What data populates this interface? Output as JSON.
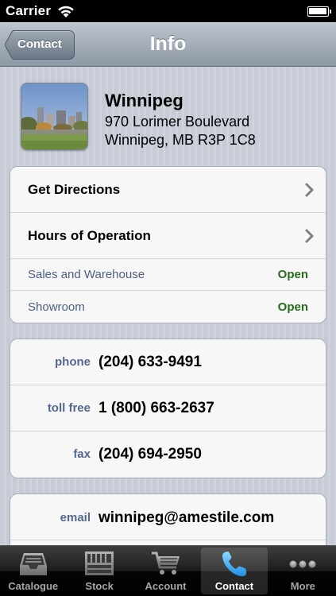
{
  "status_bar": {
    "carrier": "Carrier"
  },
  "nav": {
    "title": "Info",
    "back_label": "Contact"
  },
  "location": {
    "name": "Winnipeg",
    "address_line1": "970 Lorimer Boulevard",
    "address_line2": "Winnipeg, MB R3P 1C8"
  },
  "actions": [
    {
      "label": "Get Directions"
    },
    {
      "label": "Hours of Operation"
    }
  ],
  "hours": [
    {
      "name": "Sales and Warehouse",
      "status": "Open"
    },
    {
      "name": "Showroom",
      "status": "Open"
    }
  ],
  "phones": [
    {
      "label": "phone",
      "value": "(204) 633-9491"
    },
    {
      "label": "toll free",
      "value": "1 (800) 663-2637"
    },
    {
      "label": "fax",
      "value": "(204) 694-2950"
    }
  ],
  "email": {
    "label": "email",
    "value": "winnipeg@amestile.com"
  },
  "tabs": [
    {
      "label": "Catalogue",
      "icon": "inbox-tray-icon"
    },
    {
      "label": "Stock",
      "icon": "warehouse-shelves-icon"
    },
    {
      "label": "Account",
      "icon": "shopping-cart-icon"
    },
    {
      "label": "Contact",
      "icon": "phone-icon",
      "active": true
    },
    {
      "label": "More",
      "icon": "more-dots-icon"
    }
  ],
  "colors": {
    "status_open": "#256b1c",
    "contact_label": "#55688f",
    "hours_label": "#4c5f82"
  }
}
